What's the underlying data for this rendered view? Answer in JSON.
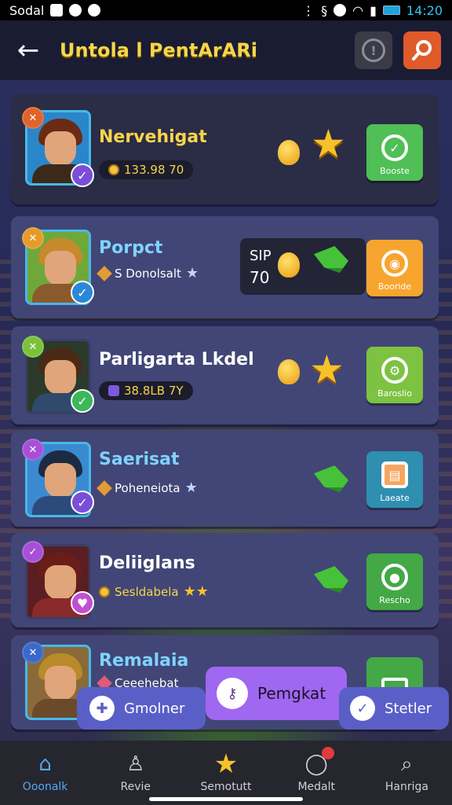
{
  "status_bar": {
    "carrier": "Sodal",
    "time": "14:20"
  },
  "header": {
    "title": "Untola l PentArARi"
  },
  "cards": [
    {
      "name": "Nervehigat",
      "sub_text": "133.98 70",
      "button_label": "Booste",
      "colors": {
        "button": "#4fbf56",
        "hair": "#6b2a14",
        "body": "#3b2a1a"
      }
    },
    {
      "name": "Porpct",
      "sub_text": "S Donolsalt",
      "score_line1": "SIP",
      "score_line2": "70",
      "button_label": "Booride",
      "colors": {
        "button": "#f7a52e",
        "hair": "#c58a2c",
        "body": "#8a5a2c"
      }
    },
    {
      "name": "Parligarta Lkdel",
      "sub_text": "38.8LB 7Y",
      "button_label": "Baroslio",
      "colors": {
        "button": "#7dc241",
        "hair": "#4a2a16",
        "body": "#2f4a6a"
      }
    },
    {
      "name": "Saerisat",
      "sub_text": "Poheneiota",
      "button_label": "Laeate",
      "colors": {
        "button": "#2e8fb0",
        "hair": "#1d2a44",
        "body": "#2c4a7a"
      }
    },
    {
      "name": "Deliiglans",
      "sub_text": "Sesldabela",
      "button_label": "Rescho",
      "colors": {
        "button": "#43a845",
        "hair": "#6a1d18",
        "body": "#8a2a2a"
      }
    },
    {
      "name": "Remalaia",
      "sub_text": "Ceeehebat",
      "button_label": "",
      "colors": {
        "button": "#43a845",
        "hair": "#b88a2a",
        "body": "#6a4a2a"
      }
    }
  ],
  "floating_bar": {
    "left_label": "Gmolner",
    "center_label": "Pemgkat",
    "right_label": "Stetler"
  },
  "bottom_nav": [
    {
      "label": "Ooonalk",
      "icon": "home-icon"
    },
    {
      "label": "Revie",
      "icon": "user-icon"
    },
    {
      "label": "Semotutt",
      "icon": "star-icon"
    },
    {
      "label": "Medalt",
      "icon": "chat-icon"
    },
    {
      "label": "Hanriga",
      "icon": "search-icon"
    }
  ]
}
